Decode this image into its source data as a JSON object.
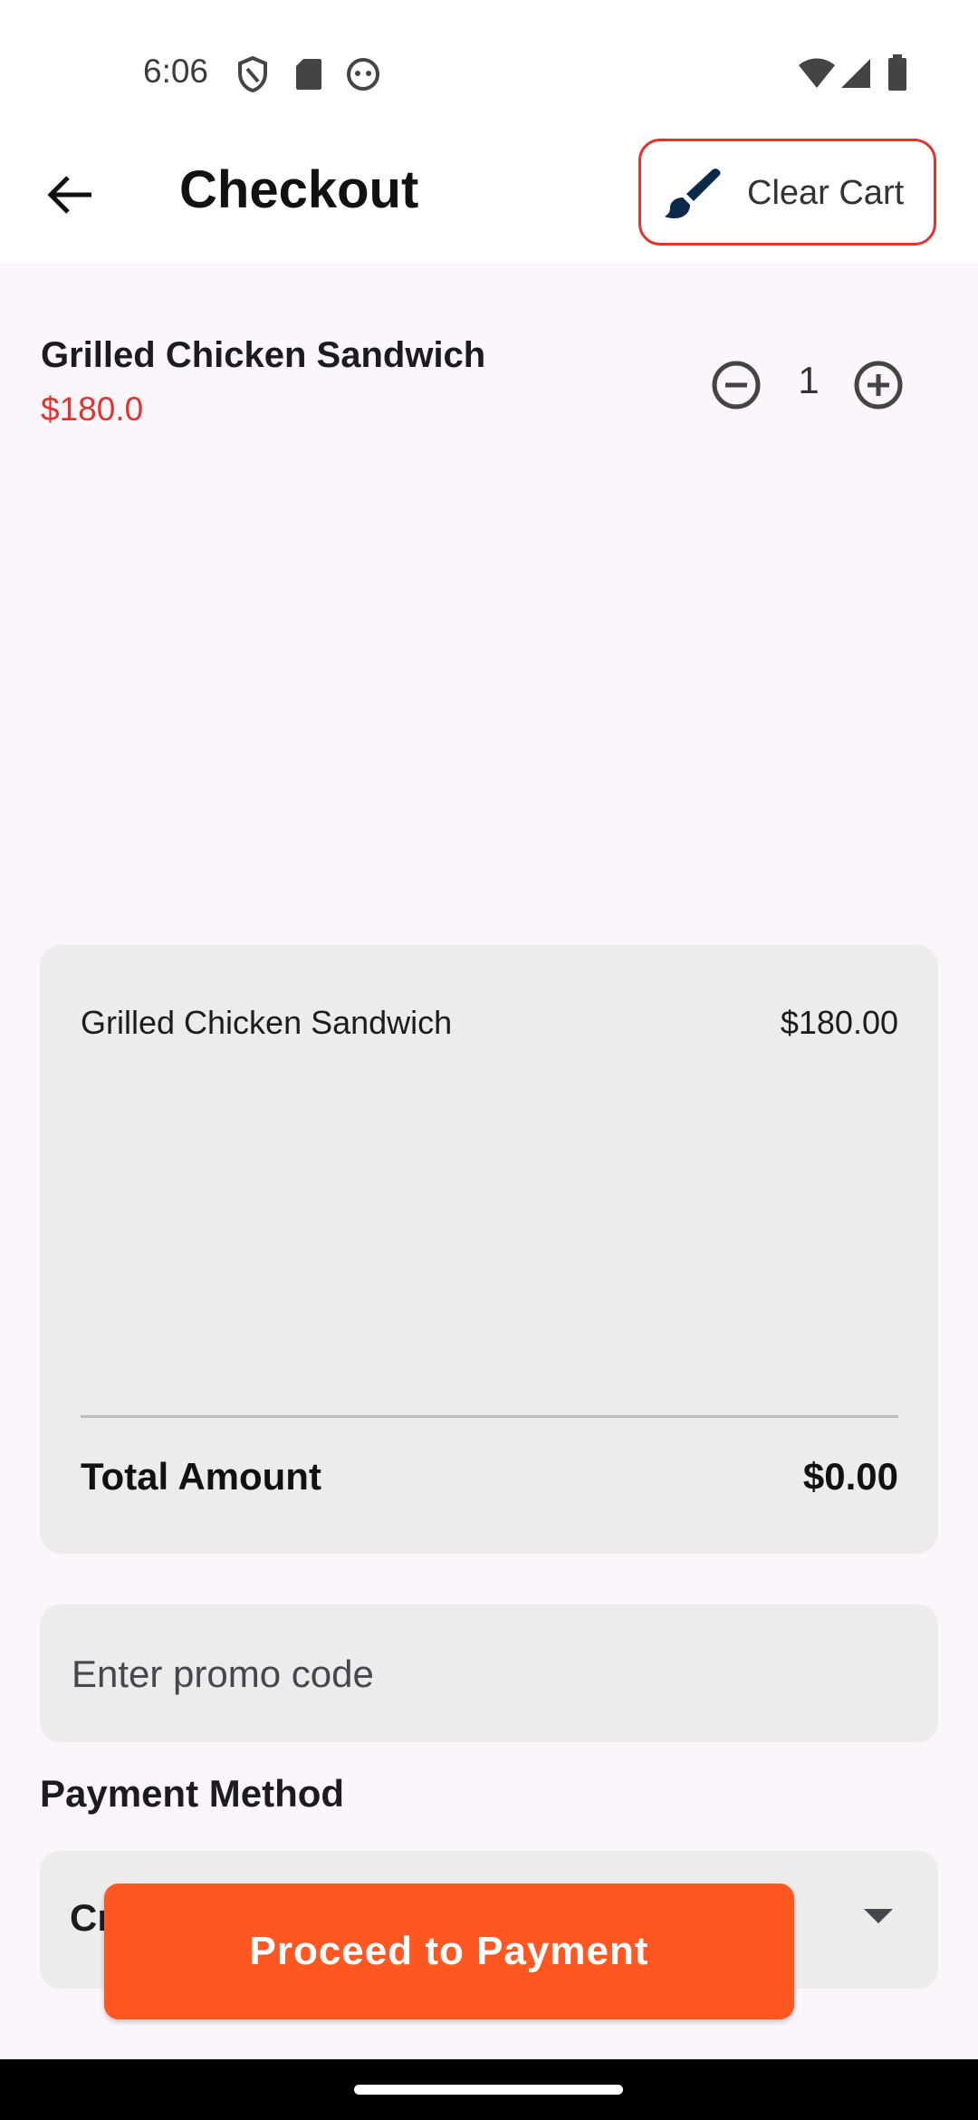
{
  "status_bar": {
    "time": "6:06",
    "icons": [
      "shield-icon",
      "sd-card-icon",
      "android-face-icon",
      "wifi-icon",
      "signal-icon",
      "battery-icon"
    ]
  },
  "app_bar": {
    "title": "Checkout",
    "back_icon": "arrow-left-icon",
    "clear_cart_label": "Clear Cart",
    "clear_cart_icon": "paint-brush-icon"
  },
  "cart_item": {
    "name": "Grilled Chicken Sandwich",
    "price": "$180.0",
    "quantity": "1"
  },
  "summary": {
    "items": [
      {
        "name": "Grilled Chicken Sandwich",
        "price": "$180.00"
      }
    ],
    "total_label": "Total Amount",
    "total_value": "$0.00"
  },
  "promo": {
    "placeholder": "Enter promo code",
    "value": ""
  },
  "payment": {
    "label": "Payment Method",
    "selected": "Cr"
  },
  "proceed_label": "Proceed to Payment",
  "colors": {
    "accent_red": "#e0342c",
    "proceed_orange": "#ff5722",
    "background": "#fcf6fc",
    "card": "#ececec",
    "brush_icon": "#0d2a4a"
  }
}
